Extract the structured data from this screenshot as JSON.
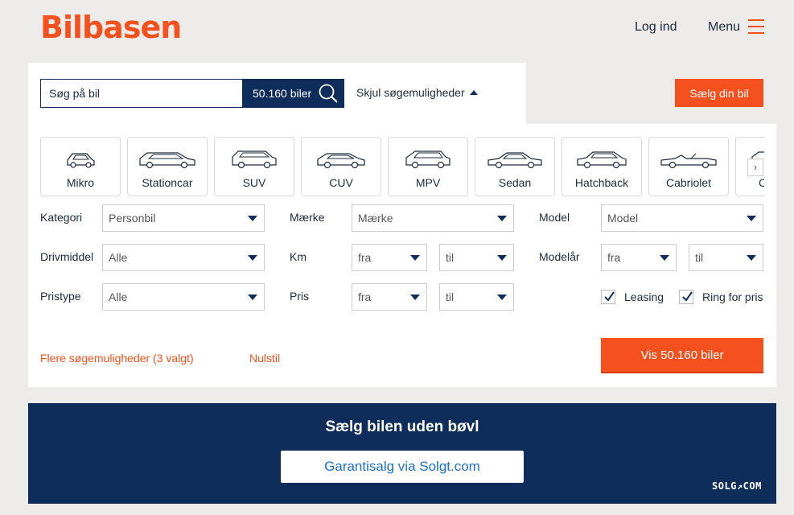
{
  "header": {
    "logo": "Bilbasen",
    "login": "Log ind",
    "menu": "Menu"
  },
  "search": {
    "placeholder": "Søg på bil",
    "count": "50.160 biler",
    "toggle": "Skjul søgemuligheder",
    "sell_button": "Sælg din bil"
  },
  "categories": [
    "Mikro",
    "Stationcar",
    "SUV",
    "CUV",
    "MPV",
    "Sedan",
    "Hatchback",
    "Cabriolet"
  ],
  "partial_category": "C",
  "filters": {
    "kategori_label": "Kategori",
    "kategori_value": "Personbil",
    "maerke_label": "Mærke",
    "maerke_value": "Mærke",
    "model_label": "Model",
    "model_value": "Model",
    "drivmiddel_label": "Drivmiddel",
    "drivmiddel_value": "Alle",
    "km_label": "Km",
    "km_from": "fra",
    "km_to": "til",
    "modelaar_label": "Modelår",
    "modelaar_from": "fra",
    "modelaar_to": "til",
    "pristype_label": "Pristype",
    "pristype_value": "Alle",
    "pris_label": "Pris",
    "pris_from": "fra",
    "pris_to": "til",
    "leasing_label": "Leasing",
    "ring_label": "Ring for pris"
  },
  "actions": {
    "more": "Flere søgemuligheder (3 valgt)",
    "reset": "Nulstil",
    "show": "Vis 50.160 biler"
  },
  "banner": {
    "title": "Sælg bilen uden bøvl",
    "button": "Garantisalg via Solgt.com",
    "logo": "SOLG↗COM"
  },
  "colors": {
    "brand": "#f5511e",
    "navy": "#0f2d5a"
  }
}
